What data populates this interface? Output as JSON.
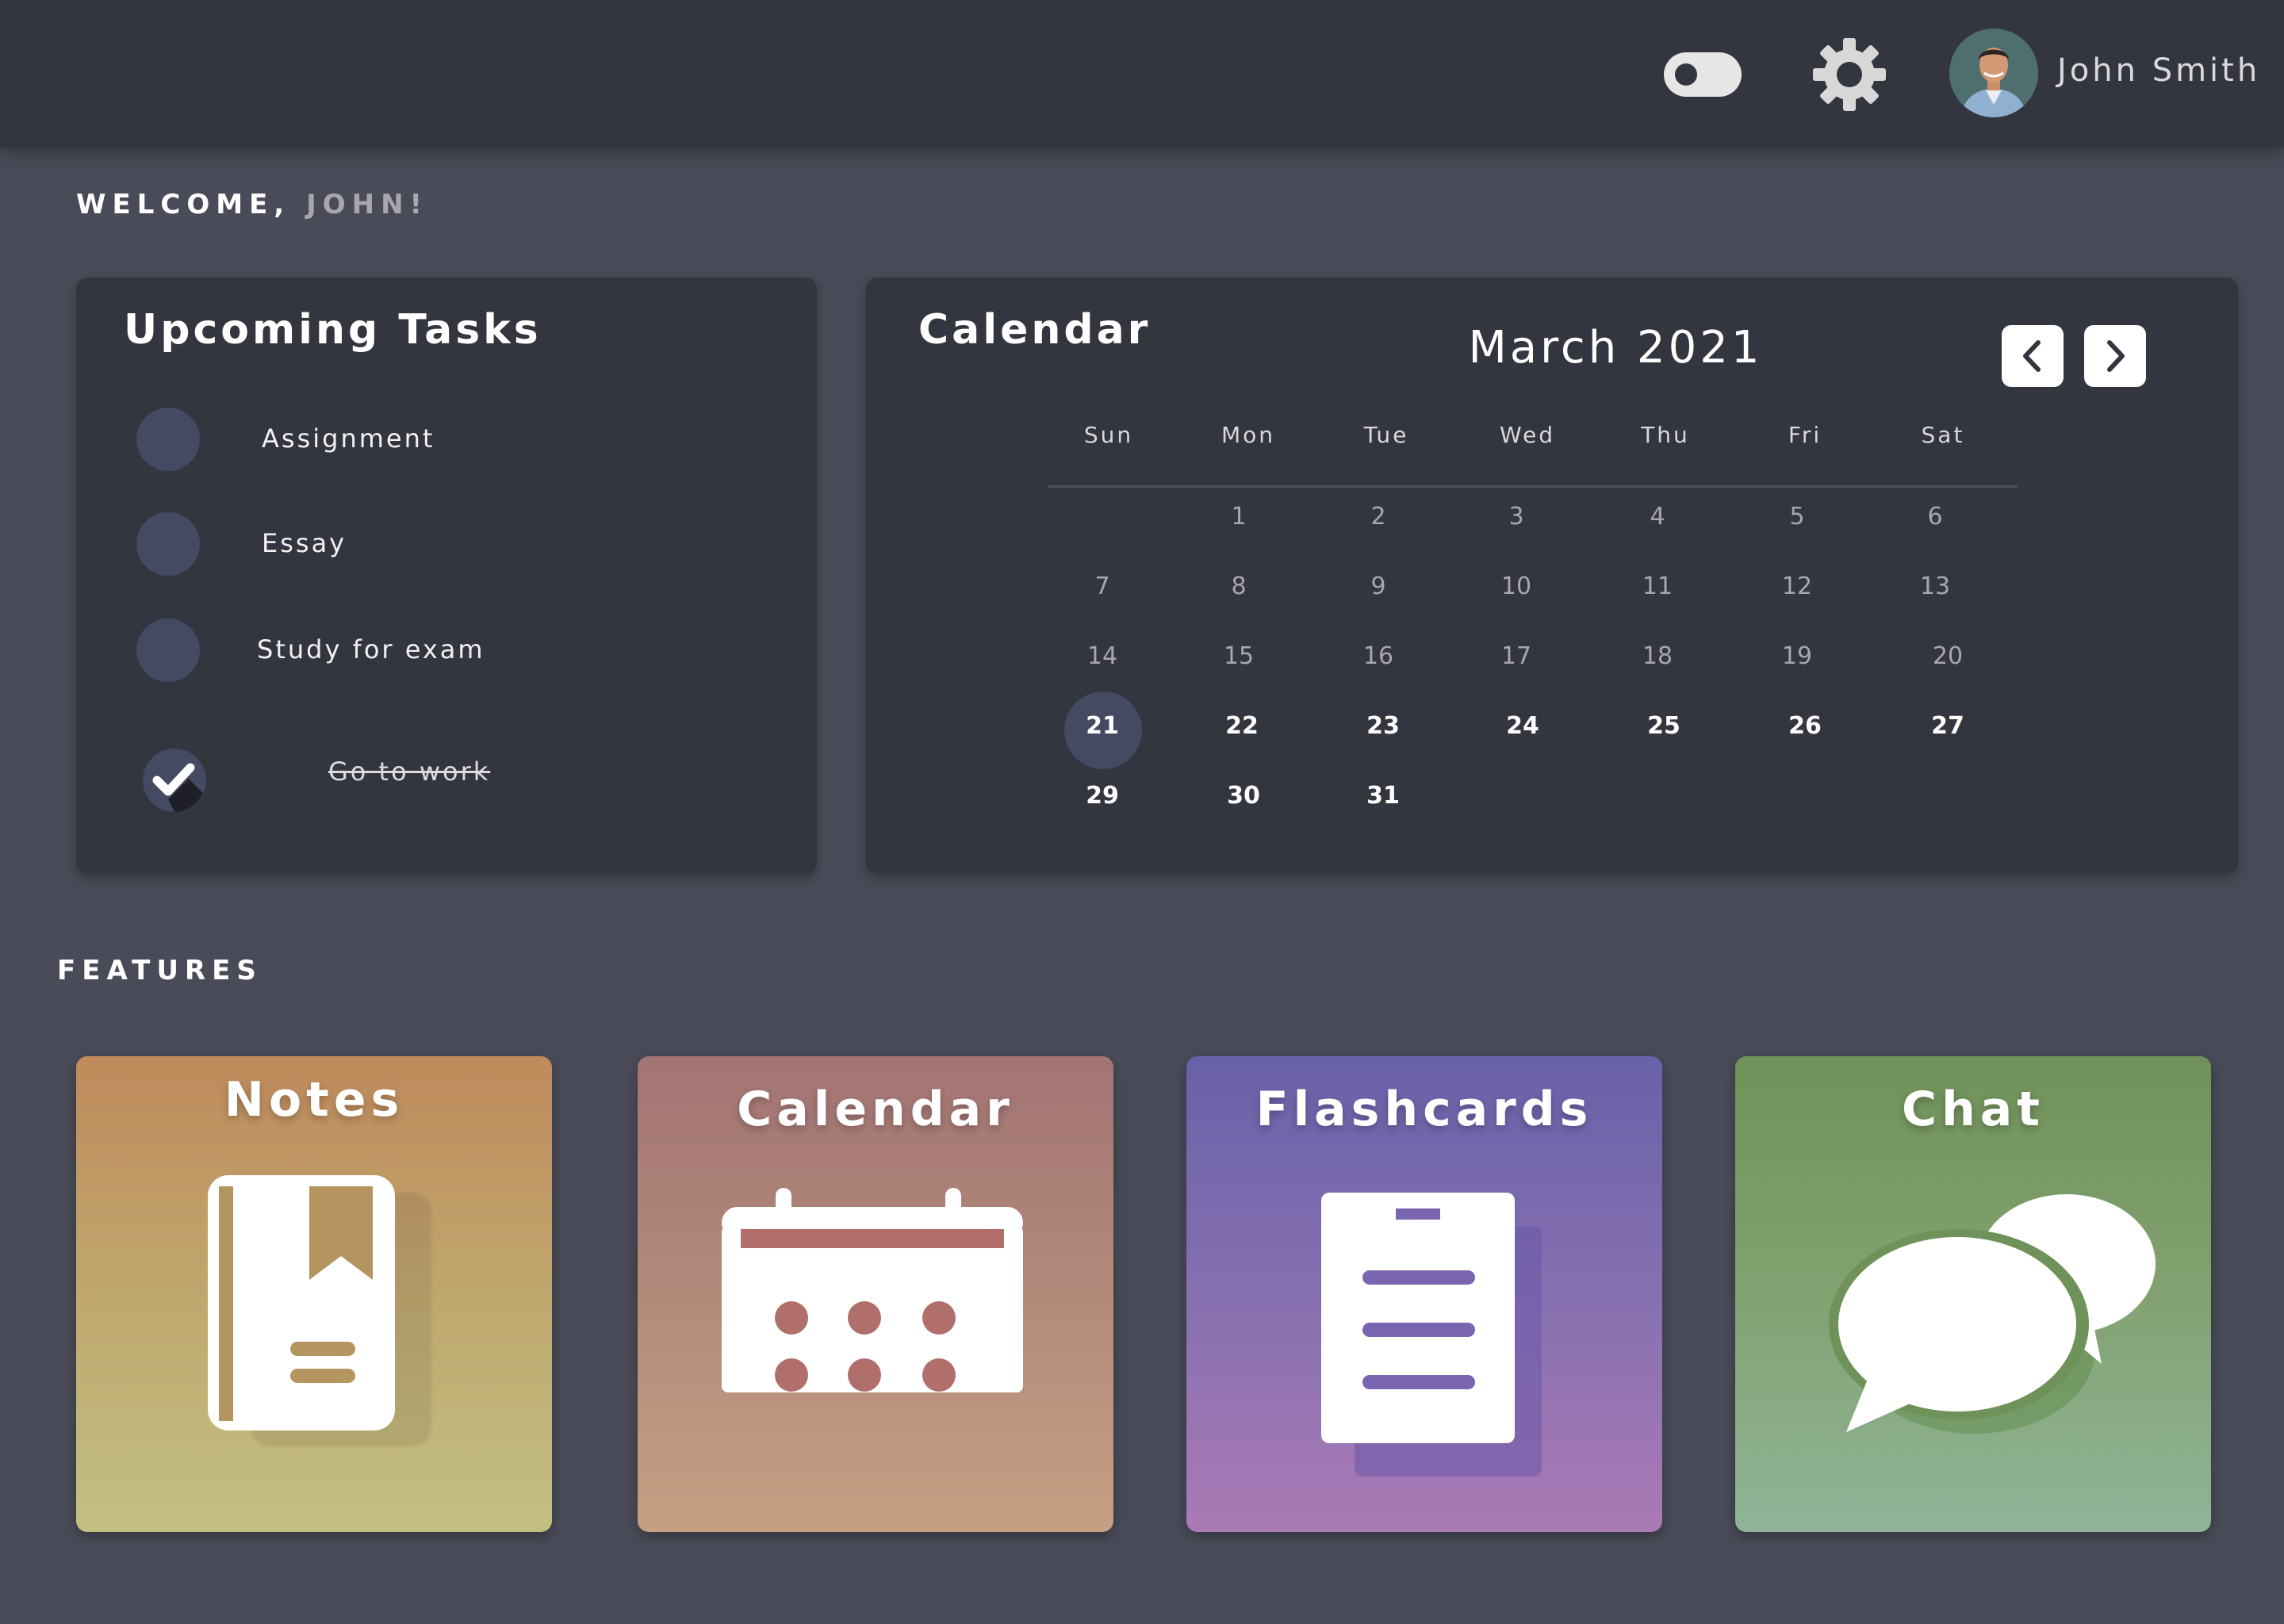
{
  "header": {
    "theme_toggle_icon": "toggle-icon",
    "settings_icon": "gear-icon",
    "user": {
      "name": "John Smith",
      "avatar_icon": "avatar"
    }
  },
  "welcome": {
    "greeting": "WELCOME,",
    "name": "JOHN!"
  },
  "tasks": {
    "title": "Upcoming Tasks",
    "items": [
      {
        "label": "Assignment",
        "done": false
      },
      {
        "label": "Essay",
        "done": false
      },
      {
        "label": "Study for exam",
        "done": false
      },
      {
        "label": "Go to work",
        "done": true
      }
    ]
  },
  "calendar": {
    "title": "Calendar",
    "month": "March 2021",
    "prev_icon": "chevron-left-icon",
    "next_icon": "chevron-right-icon",
    "weekdays": [
      "Sun",
      "Mon",
      "Tue",
      "Wed",
      "Thu",
      "Fri",
      "Sat"
    ],
    "weeks": [
      [
        "",
        "1",
        "2",
        "3",
        "4",
        "5",
        "6"
      ],
      [
        "7",
        "8",
        "9",
        "10",
        "11",
        "12",
        "13"
      ],
      [
        "14",
        "15",
        "16",
        "17",
        "18",
        "19",
        "20"
      ],
      [
        "21",
        "22",
        "23",
        "24",
        "25",
        "26",
        "27"
      ],
      [
        "29",
        "30",
        "31",
        "",
        "",
        "",
        ""
      ]
    ],
    "today": "21"
  },
  "features": {
    "heading": "FEATURES",
    "items": [
      {
        "label": "Notes",
        "icon": "notebook-icon"
      },
      {
        "label": "Calendar",
        "icon": "calendar-icon"
      },
      {
        "label": "Flashcards",
        "icon": "flashcards-icon"
      },
      {
        "label": "Chat",
        "icon": "chat-icon"
      }
    ]
  },
  "colors": {
    "background": "#494b58",
    "topbar": "#33353f",
    "card": "#33353f",
    "task_circle": "#454a63",
    "notes_accent": "#b59560",
    "calendar_accent": "#b06f6a",
    "flashcards_accent": "#7a66b0",
    "chat_accent": "#6f915a"
  }
}
